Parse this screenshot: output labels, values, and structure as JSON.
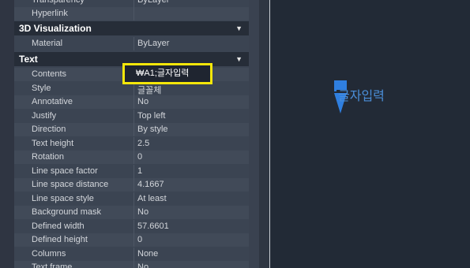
{
  "properties": {
    "top_rows": [
      {
        "label": "Transparency",
        "value": "ByLayer"
      },
      {
        "label": "Hyperlink",
        "value": ""
      }
    ],
    "sections": {
      "viz": {
        "title": "3D Visualization",
        "rows": [
          {
            "label": "Material",
            "value": "ByLayer"
          }
        ]
      },
      "text": {
        "title": "Text",
        "rows": [
          {
            "label": "Contents",
            "value": "₩A1;글자입력"
          },
          {
            "label": "Style",
            "value": "글꼴체"
          },
          {
            "label": "Annotative",
            "value": "No"
          },
          {
            "label": "Justify",
            "value": "Top left"
          },
          {
            "label": "Direction",
            "value": "By style"
          },
          {
            "label": "Text height",
            "value": "2.5"
          },
          {
            "label": "Rotation",
            "value": "0"
          },
          {
            "label": "Line space factor",
            "value": "1"
          },
          {
            "label": "Line space distance",
            "value": "4.1667"
          },
          {
            "label": "Line space style",
            "value": "At least"
          },
          {
            "label": "Background mask",
            "value": "No"
          },
          {
            "label": "Defined width",
            "value": "57.6601"
          },
          {
            "label": "Defined height",
            "value": "0"
          },
          {
            "label": "Columns",
            "value": "None"
          },
          {
            "label": "Text frame",
            "value": "No"
          }
        ]
      }
    }
  },
  "highlight_value": "₩A1;글자입력",
  "canvas": {
    "text": "글자입력"
  },
  "colors": {
    "accent_blue": "#2f7fe0",
    "highlight_yellow": "#f5e70a"
  }
}
